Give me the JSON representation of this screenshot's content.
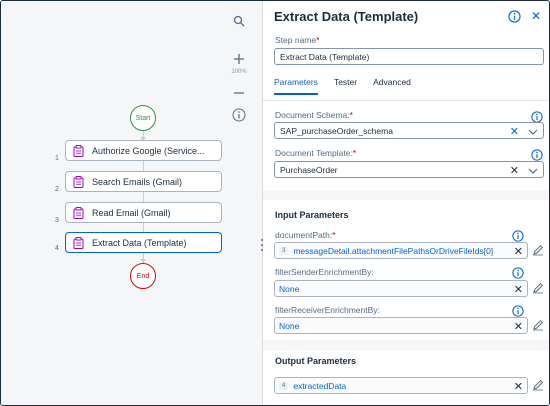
{
  "canvas": {
    "zoom_level": "100%",
    "start_label": "Start",
    "end_label": "End",
    "steps": [
      {
        "number": "1",
        "label": "Authorize Google (Service..."
      },
      {
        "number": "2",
        "label": "Search Emails (Gmail)"
      },
      {
        "number": "3",
        "label": "Read Email (Gmail)"
      },
      {
        "number": "4",
        "label": "Extract Data (Template)"
      }
    ]
  },
  "panel": {
    "title": "Extract Data (Template)",
    "step_name_label": "Step name",
    "step_name_value": "Extract Data (Template)",
    "tabs": [
      "Parameters",
      "Tester",
      "Advanced"
    ],
    "active_tab": "Parameters",
    "document_schema_label": "Document Schema:",
    "document_schema_value": "SAP_purchaseOrder_schema",
    "document_template_label": "Document Template:",
    "document_template_value": "PurchaseOrder",
    "required_mark": "*",
    "input_parameters_title": "Input Parameters",
    "input_params": {
      "document_path": {
        "label": "documentPath:",
        "token": "3",
        "value": "messageDetail.attachmentFilePathsOrDriveFileIds[0]"
      },
      "filter_sender": {
        "label": "filterSenderEnrichmentBy:",
        "value": "None"
      },
      "filter_receiver": {
        "label": "filterReceiverEnrichmentBy:",
        "value": "None"
      }
    },
    "output_parameters_title": "Output Parameters",
    "output_param": {
      "token": "4",
      "value": "extractedData"
    }
  },
  "colors": {
    "accent": "#0064d9",
    "start": "#30914c",
    "end": "#d20a0a",
    "step_icon": "#a100c2"
  }
}
